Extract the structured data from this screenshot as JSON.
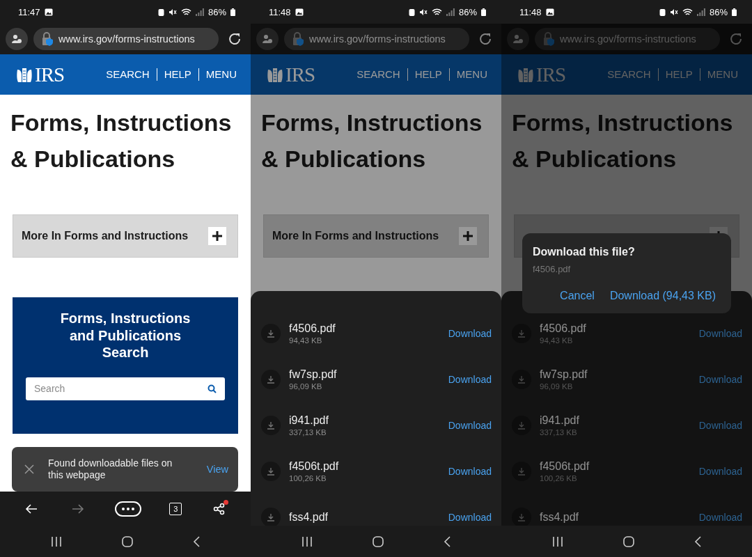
{
  "screens": [
    {
      "kind": "page",
      "time": "11:47",
      "battery": "86%",
      "url": "www.irs.gov/forms-instructions",
      "logo": "IRS",
      "nav": [
        "SEARCH",
        "HELP",
        "MENU"
      ],
      "heading": "Forms, Instructions & Publications",
      "accordion": {
        "label": "More In Forms and Instructions",
        "expanded": false
      },
      "search_card": {
        "title": "Forms, Instructions and Publications Search",
        "placeholder": "Search"
      },
      "toast": {
        "message": "Found downloadable files on this webpage",
        "action": "View"
      },
      "toolbar": {
        "tab_count": "3",
        "forward_disabled": true,
        "share_badge": true
      }
    },
    {
      "kind": "sheet",
      "time": "11:48",
      "battery": "86%",
      "url": "www.irs.gov/forms-instructions",
      "logo": "IRS",
      "nav": [
        "SEARCH",
        "HELP",
        "MENU"
      ],
      "heading": "Forms, Instructions & Publications",
      "accordion": {
        "label": "More In Forms and Instructions",
        "expanded": false
      },
      "sheet": {
        "files": [
          {
            "name": "f4506.pdf",
            "size": "94,43 KB",
            "action": "Download"
          },
          {
            "name": "fw7sp.pdf",
            "size": "96,09 KB",
            "action": "Download"
          },
          {
            "name": "i941.pdf",
            "size": "337,13 KB",
            "action": "Download"
          },
          {
            "name": "f4506t.pdf",
            "size": "100,26 KB",
            "action": "Download"
          },
          {
            "name": "fss4.pdf",
            "action": "Download"
          }
        ]
      }
    },
    {
      "kind": "dialog",
      "time": "11:48",
      "battery": "86%",
      "url": "www.irs.gov/forms-instructions",
      "logo": "IRS",
      "nav": [
        "SEARCH",
        "HELP",
        "MENU"
      ],
      "heading": "Forms, Instructions & Publications",
      "accordion": {
        "expanded": false
      },
      "sheet": {
        "files": [
          {
            "name": "f4506.pdf",
            "size": "94,43 KB",
            "action": "Download"
          },
          {
            "name": "fw7sp.pdf",
            "size": "96,09 KB",
            "action": "Download"
          },
          {
            "name": "i941.pdf",
            "size": "337,13 KB",
            "action": "Download"
          },
          {
            "name": "f4506t.pdf",
            "size": "100,26 KB",
            "action": "Download"
          },
          {
            "name": "fss4.pdf",
            "action": "Download"
          }
        ]
      },
      "dialog": {
        "title": "Download this file?",
        "file": "f4506.pdf",
        "cancel": "Cancel",
        "confirm": "Download (94,43 KB)"
      }
    }
  ]
}
